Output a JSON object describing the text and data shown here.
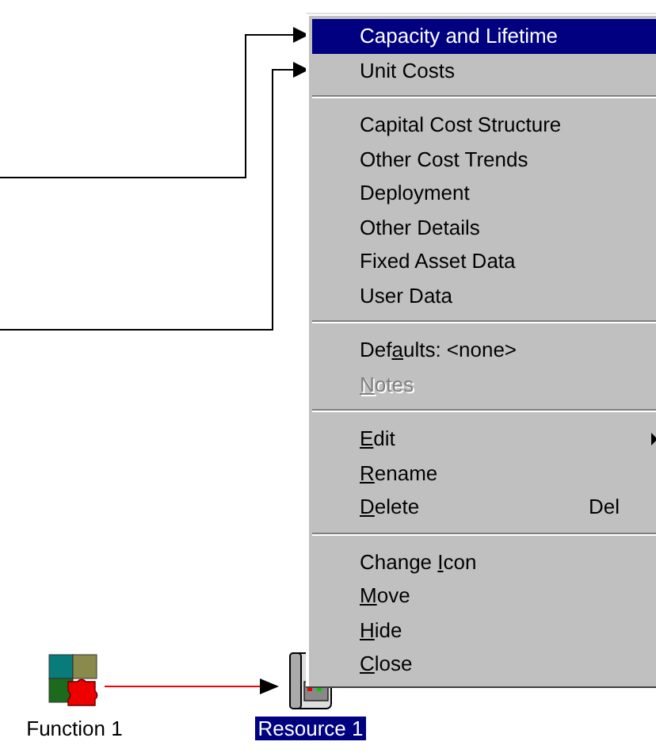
{
  "context_menu": {
    "sections": [
      [
        {
          "before": "Capacity and Lifetime",
          "selected": true,
          "disabled": false
        },
        {
          "before": "Unit Costs",
          "selected": false,
          "disabled": false
        }
      ],
      [
        {
          "before": "Capital Cost Structure",
          "selected": false,
          "disabled": false
        },
        {
          "before": "Other Cost Trends",
          "selected": false,
          "disabled": false
        },
        {
          "before": "Deployment",
          "selected": false,
          "disabled": false
        },
        {
          "before": "Other Details",
          "selected": false,
          "disabled": false
        },
        {
          "before": "Fixed Asset Data",
          "selected": false,
          "disabled": false
        },
        {
          "before": "User Data",
          "selected": false,
          "disabled": false
        }
      ],
      [
        {
          "before": "Def",
          "key": "a",
          "after": "ults: <none>",
          "selected": false,
          "disabled": false
        },
        {
          "key": "N",
          "after": "otes",
          "selected": false,
          "disabled": true
        }
      ],
      [
        {
          "key": "E",
          "after": "dit",
          "selected": false,
          "disabled": false,
          "submenu": true
        },
        {
          "key": "R",
          "after": "ename",
          "selected": false,
          "disabled": false
        },
        {
          "key": "D",
          "after": "elete",
          "shortcut": "Del",
          "selected": false,
          "disabled": false
        }
      ],
      [
        {
          "before": "Change ",
          "key": "I",
          "after": "con",
          "selected": false,
          "disabled": false
        },
        {
          "key": "M",
          "after": "ove",
          "selected": false,
          "disabled": false
        },
        {
          "key": "H",
          "after": "ide",
          "selected": false,
          "disabled": false
        },
        {
          "key": "C",
          "after": "lose",
          "selected": false,
          "disabled": false
        }
      ]
    ]
  },
  "diagram": {
    "nodes": [
      {
        "kind": "function",
        "label": "Function 1",
        "selected": false
      },
      {
        "kind": "resource",
        "label": "Resource 1",
        "selected": true
      }
    ]
  }
}
